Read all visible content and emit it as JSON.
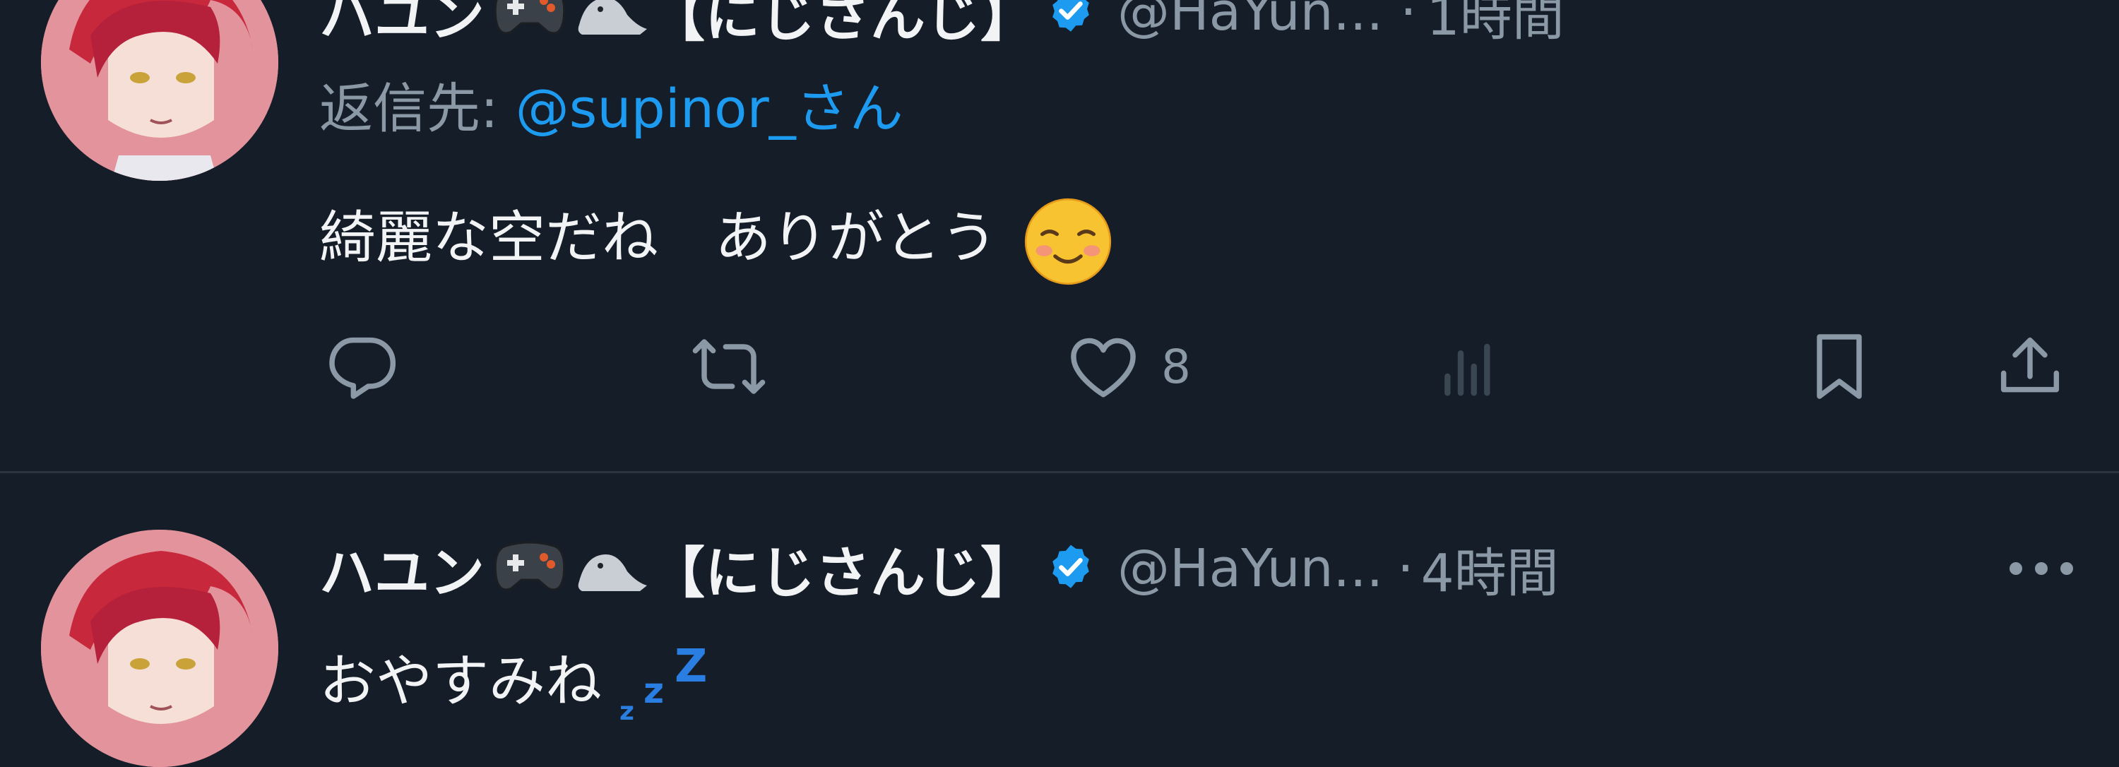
{
  "tweets": [
    {
      "display_name": "ハユン",
      "brand": "【にじさんじ】",
      "handle": "@HaYun...",
      "dot": "·",
      "time": "1時間",
      "reply_prefix": "返信先: ",
      "reply_mention": "@supinor_さん",
      "text": "綺麗な空だね　ありがとう",
      "emoji": "smiling-face-icon",
      "actions": {
        "reply_icon": "reply-icon",
        "retweet_icon": "retweet-icon",
        "like_icon": "heart-icon",
        "like_count": "8",
        "views_icon": "views-icon",
        "bookmark_icon": "bookmark-icon",
        "share_icon": "share-icon"
      }
    },
    {
      "display_name": "ハユン",
      "brand": "【にじさんじ】",
      "handle": "@HaYun...",
      "dot": "·",
      "time": "4時間",
      "more_icon": "more-icon",
      "text": "おやすみね",
      "emoji": "sleeping-zzz-icon"
    }
  ],
  "colors": {
    "background": "#151d28",
    "text": "#f2f3f4",
    "muted": "#8b98a5",
    "accent": "#1d9bf0"
  }
}
